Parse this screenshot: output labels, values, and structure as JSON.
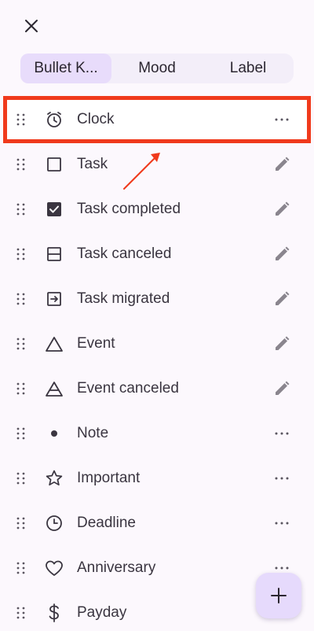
{
  "tabs": [
    {
      "label": "Bullet K...",
      "active": true
    },
    {
      "label": "Mood",
      "active": false
    },
    {
      "label": "Label",
      "active": false
    }
  ],
  "rows": [
    {
      "label": "Clock",
      "icon": "clock-icon",
      "action": "more"
    },
    {
      "label": "Task",
      "icon": "square-icon",
      "action": "edit"
    },
    {
      "label": "Task completed",
      "icon": "checked-box-icon",
      "action": "edit"
    },
    {
      "label": "Task canceled",
      "icon": "canceled-box-icon",
      "action": "edit"
    },
    {
      "label": "Task migrated",
      "icon": "migrated-box-icon",
      "action": "edit"
    },
    {
      "label": "Event",
      "icon": "triangle-icon",
      "action": "edit"
    },
    {
      "label": "Event canceled",
      "icon": "canceled-triangle-icon",
      "action": "edit"
    },
    {
      "label": "Note",
      "icon": "dot-icon",
      "action": "more"
    },
    {
      "label": "Important",
      "icon": "star-icon",
      "action": "more"
    },
    {
      "label": "Deadline",
      "icon": "deadline-clock-icon",
      "action": "more"
    },
    {
      "label": "Anniversary",
      "icon": "heart-icon",
      "action": "more"
    },
    {
      "label": "Payday",
      "icon": "dollar-icon",
      "action": "more"
    }
  ],
  "fab": {
    "symbol": "+"
  },
  "colors": {
    "highlight": "#f03a1c",
    "tab_active": "#e8dcfb",
    "fab": "#e6dafc",
    "background": "#fcf8fd"
  }
}
